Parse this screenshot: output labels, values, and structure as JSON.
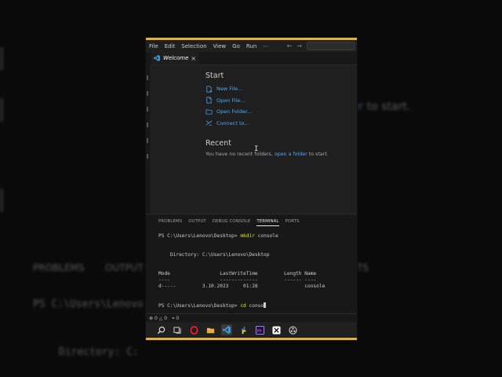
{
  "menu": {
    "items": [
      "File",
      "Edit",
      "Selection",
      "View",
      "Go",
      "Run",
      "⋯"
    ]
  },
  "tab": {
    "label": "Welcome",
    "close": "×"
  },
  "welcome": {
    "start_heading": "Start",
    "start_items": [
      {
        "label": "New File...",
        "icon": "new-file-icon"
      },
      {
        "label": "Open File...",
        "icon": "open-file-icon"
      },
      {
        "label": "Open Folder...",
        "icon": "open-folder-icon"
      },
      {
        "label": "Connect to...",
        "icon": "remote-connect-icon"
      }
    ],
    "recent_heading": "Recent",
    "recent_text_before": "You have no recent folders,",
    "recent_link": "open a folder",
    "recent_text_after": "to start."
  },
  "panel": {
    "tabs": [
      "PROBLEMS",
      "OUTPUT",
      "DEBUG CONSOLE",
      "TERMINAL",
      "PORTS"
    ],
    "active_tab": "TERMINAL"
  },
  "terminal": {
    "prompt1": "PS C:\\Users\\Lenovo\\Desktop> ",
    "cmd1": "mkdir",
    "arg1": " console",
    "directory_line": "    Directory: C:\\Users\\Lenovo\\Desktop",
    "header": "Mode                 LastWriteTime         Length Name",
    "divider": "----                 -------------         ------ ----",
    "row": "d-----         3.10.2023     01:28                console",
    "prompt2": "PS C:\\Users\\Lenovo\\Desktop> ",
    "cmd2": "cd",
    "arg2": " conso"
  },
  "status": {
    "errors": "0",
    "warnings": "0",
    "ports": "0"
  },
  "background": {
    "link_text": "der to start.",
    "panel_tabs": [
      "PROBLEMS",
      "OUTPUT",
      "TS"
    ],
    "ps_line": "PS C:\\Users\\Lenovo",
    "dir_line": "Directory: C:"
  },
  "colors": {
    "accent_strip": "#e0b341",
    "link": "#4daafc",
    "command": "#e5e510"
  }
}
